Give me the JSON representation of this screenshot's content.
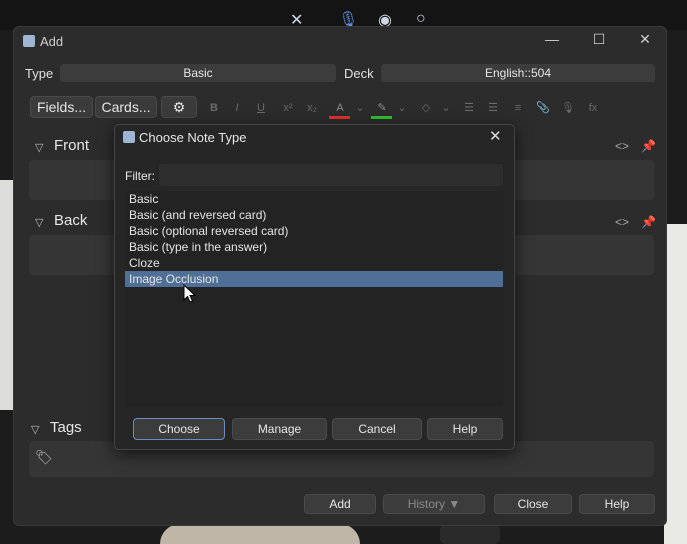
{
  "window": {
    "title": "Add"
  },
  "window_controls": {
    "minimize": "—",
    "maximize": "☐",
    "close": "✕"
  },
  "type_row": {
    "type_label": "Type",
    "type_value": "Basic",
    "deck_label": "Deck",
    "deck_value": "English::504"
  },
  "toolbar": {
    "fields_label": "Fields...",
    "cards_label": "Cards...",
    "settings_icon": "⚙",
    "format_buttons": [
      "B",
      "I",
      "U",
      "x²",
      "x₂",
      "A",
      "⌄",
      "✎",
      "⌄",
      "◇",
      "⌄",
      "☰",
      "☰",
      "≡",
      "📎",
      "🎙",
      "fx"
    ]
  },
  "sections": {
    "front": "Front",
    "back": "Back",
    "tags": "Tags"
  },
  "section_icons": {
    "html_toggle": "<>",
    "pin": "📌",
    "tag": "🏷"
  },
  "bottom": {
    "add": "Add",
    "history": "History ▼",
    "close": "Close",
    "help": "Help"
  },
  "dialog": {
    "title": "Choose Note Type",
    "close": "✕",
    "filter_label": "Filter:",
    "filter_value": "",
    "items": [
      "Basic",
      "Basic (and reversed card)",
      "Basic (optional reversed card)",
      "Basic (type in the answer)",
      "Cloze",
      "Image Occlusion"
    ],
    "selected_index": 5,
    "buttons": {
      "choose": "Choose",
      "manage": "Manage",
      "cancel": "Cancel",
      "help": "Help"
    }
  },
  "colors": {
    "selection": "#4f6f96",
    "primary_border": "#6b8cc0",
    "text_color_bar": "#e03030",
    "highlight_bar": "#30c030"
  }
}
